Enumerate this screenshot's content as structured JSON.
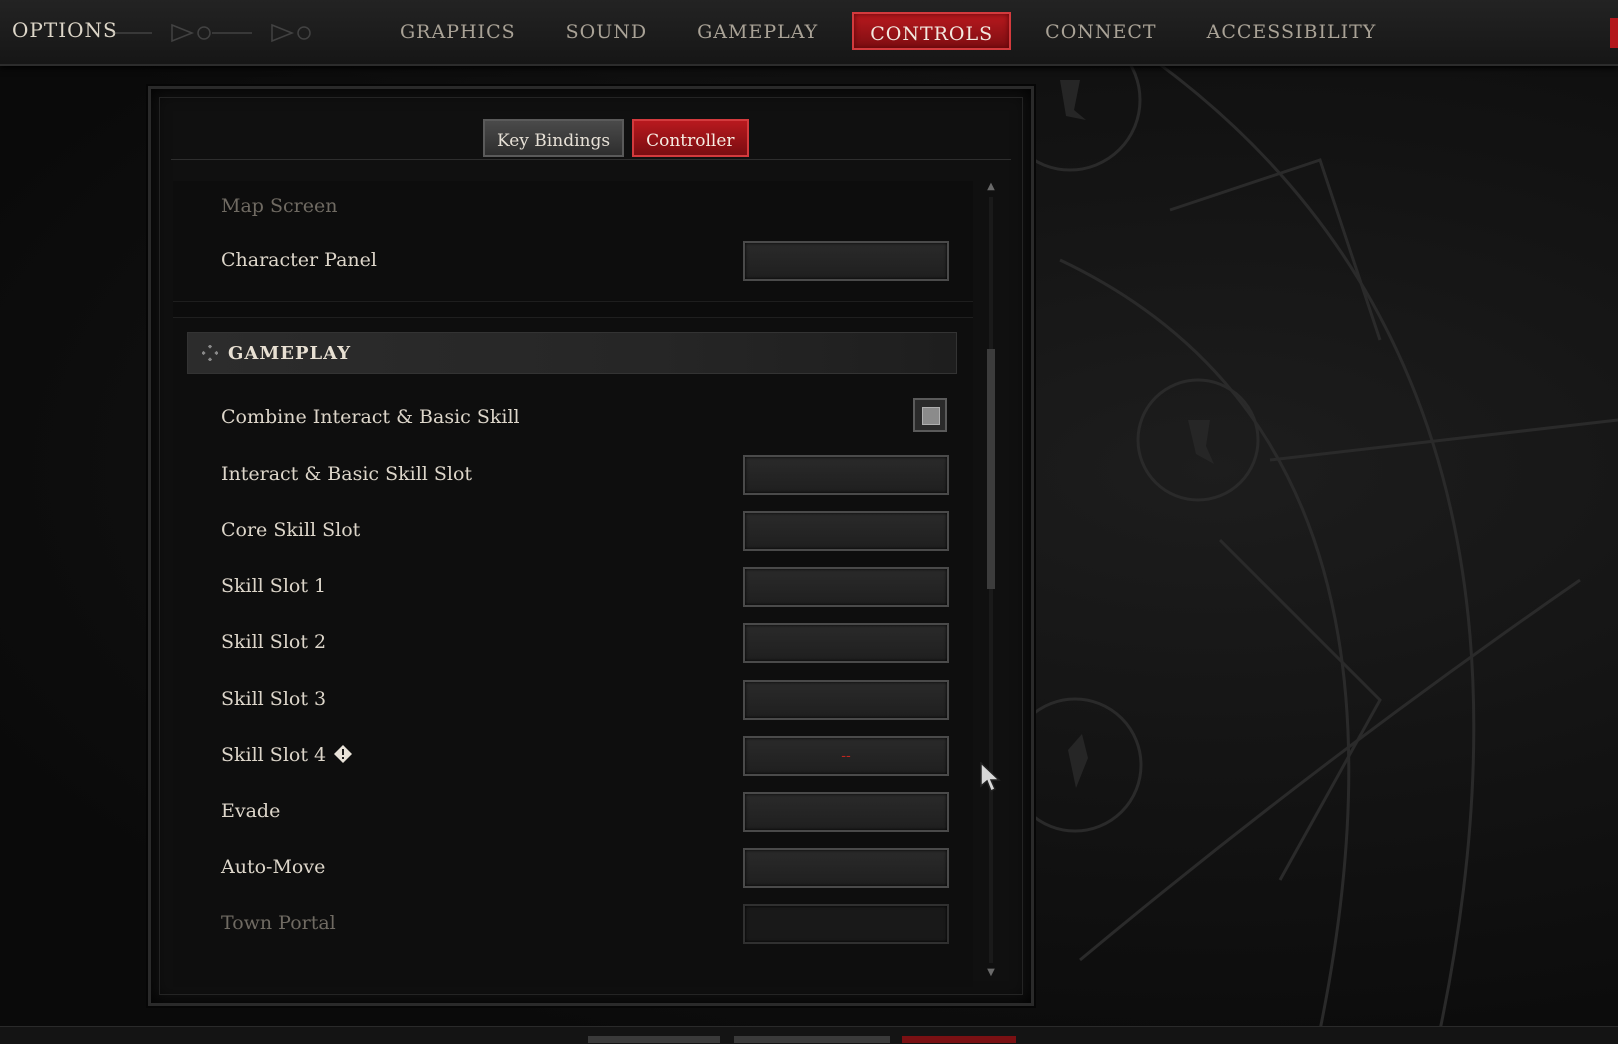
{
  "header": {
    "title": "OPTIONS",
    "tabs": [
      {
        "label": "GRAPHICS"
      },
      {
        "label": "SOUND"
      },
      {
        "label": "GAMEPLAY"
      },
      {
        "label": "CONTROLS"
      },
      {
        "label": "CONNECT"
      },
      {
        "label": "ACCESSIBILITY"
      }
    ],
    "active_tab": "CONTROLS"
  },
  "subtabs": {
    "key_bindings": "Key Bindings",
    "controller": "Controller",
    "active": "Controller"
  },
  "top_group": {
    "rows": [
      {
        "label": "Map Screen"
      },
      {
        "label": "Character Panel"
      }
    ]
  },
  "gameplay": {
    "title": "GAMEPLAY",
    "combine": {
      "label": "Combine Interact & Basic Skill",
      "checked": false
    },
    "rows": [
      {
        "label": "Interact & Basic Skill Slot",
        "value": ""
      },
      {
        "label": "Core Skill Slot",
        "value": ""
      },
      {
        "label": "Skill Slot 1",
        "value": ""
      },
      {
        "label": "Skill Slot 2",
        "value": ""
      },
      {
        "label": "Skill Slot 3",
        "value": ""
      },
      {
        "label": "Skill Slot 4",
        "value": "--",
        "warning_icon": "warning-diamond-icon"
      },
      {
        "label": "Evade",
        "value": ""
      },
      {
        "label": "Auto-Move",
        "value": ""
      },
      {
        "label": "Town Portal",
        "value": ""
      }
    ]
  },
  "colors": {
    "accent": "#b8191e",
    "panel": "#101010",
    "text": "#ddd6ca"
  }
}
